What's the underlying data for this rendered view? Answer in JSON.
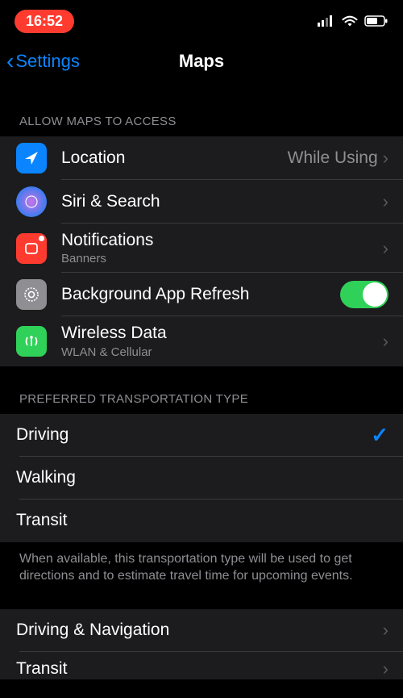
{
  "status": {
    "time": "16:52"
  },
  "nav": {
    "back_label": "Settings",
    "title": "Maps"
  },
  "sections": {
    "access": {
      "header": "ALLOW MAPS TO ACCESS",
      "location": {
        "title": "Location",
        "value": "While Using"
      },
      "siri": {
        "title": "Siri & Search"
      },
      "notifications": {
        "title": "Notifications",
        "sub": "Banners"
      },
      "bgrefresh": {
        "title": "Background App Refresh",
        "on": true
      },
      "wireless": {
        "title": "Wireless Data",
        "sub": "WLAN & Cellular"
      }
    },
    "transport": {
      "header": "PREFERRED TRANSPORTATION TYPE",
      "options": {
        "driving": "Driving",
        "walking": "Walking",
        "transit": "Transit"
      },
      "selected": "driving",
      "footer": "When available, this transportation type will be used to get directions and to estimate travel time for upcoming events."
    },
    "more": {
      "driving_nav": "Driving & Navigation",
      "transit": "Transit"
    }
  }
}
